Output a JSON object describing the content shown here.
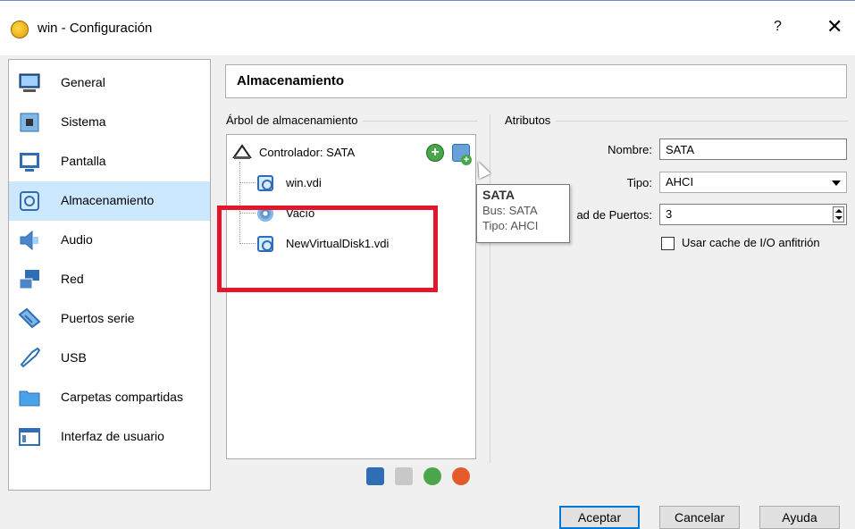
{
  "window": {
    "title": "win - Configuración",
    "help_label": "?",
    "close_label": "✕"
  },
  "sidebar": {
    "items": [
      {
        "label": "General",
        "icon": "monitor-icon"
      },
      {
        "label": "Sistema",
        "icon": "chip-icon"
      },
      {
        "label": "Pantalla",
        "icon": "display-icon"
      },
      {
        "label": "Almacenamiento",
        "icon": "storage-icon",
        "active": true
      },
      {
        "label": "Audio",
        "icon": "speaker-icon"
      },
      {
        "label": "Red",
        "icon": "network-icon"
      },
      {
        "label": "Puertos serie",
        "icon": "serial-port-icon"
      },
      {
        "label": "USB",
        "icon": "usb-icon"
      },
      {
        "label": "Carpetas compartidas",
        "icon": "folder-icon"
      },
      {
        "label": "Interfaz de usuario",
        "icon": "ui-icon"
      }
    ]
  },
  "section_title": "Almacenamiento",
  "storage_tree": {
    "group_label": "Árbol de almacenamiento",
    "controller": "Controlador: SATA",
    "items": [
      {
        "label": "win.vdi",
        "type": "hard-disk"
      },
      {
        "label": "Vacío",
        "type": "optical"
      },
      {
        "label": "NewVirtualDisk1.vdi",
        "type": "hard-disk"
      }
    ]
  },
  "tooltip": {
    "title": "SATA",
    "bus_label": "Bus:",
    "bus_value": "SATA",
    "type_label": "Tipo:",
    "type_value": "AHCI"
  },
  "attributes": {
    "group_label": "Atributos",
    "name_label": "Nombre:",
    "name_value": "SATA",
    "type_label": "Tipo:",
    "type_value": "AHCI",
    "ports_label_visible": "ad de Puertos:",
    "ports_value": "3",
    "cache_label": "Usar cache de I/O anfitrión",
    "cache_checked": false
  },
  "buttons": {
    "ok": "Aceptar",
    "cancel": "Cancelar",
    "help": "Ayuda"
  },
  "colors": {
    "selection": "#cce8ff",
    "highlight_box": "#e3162b",
    "primary_border": "#0078d7"
  }
}
